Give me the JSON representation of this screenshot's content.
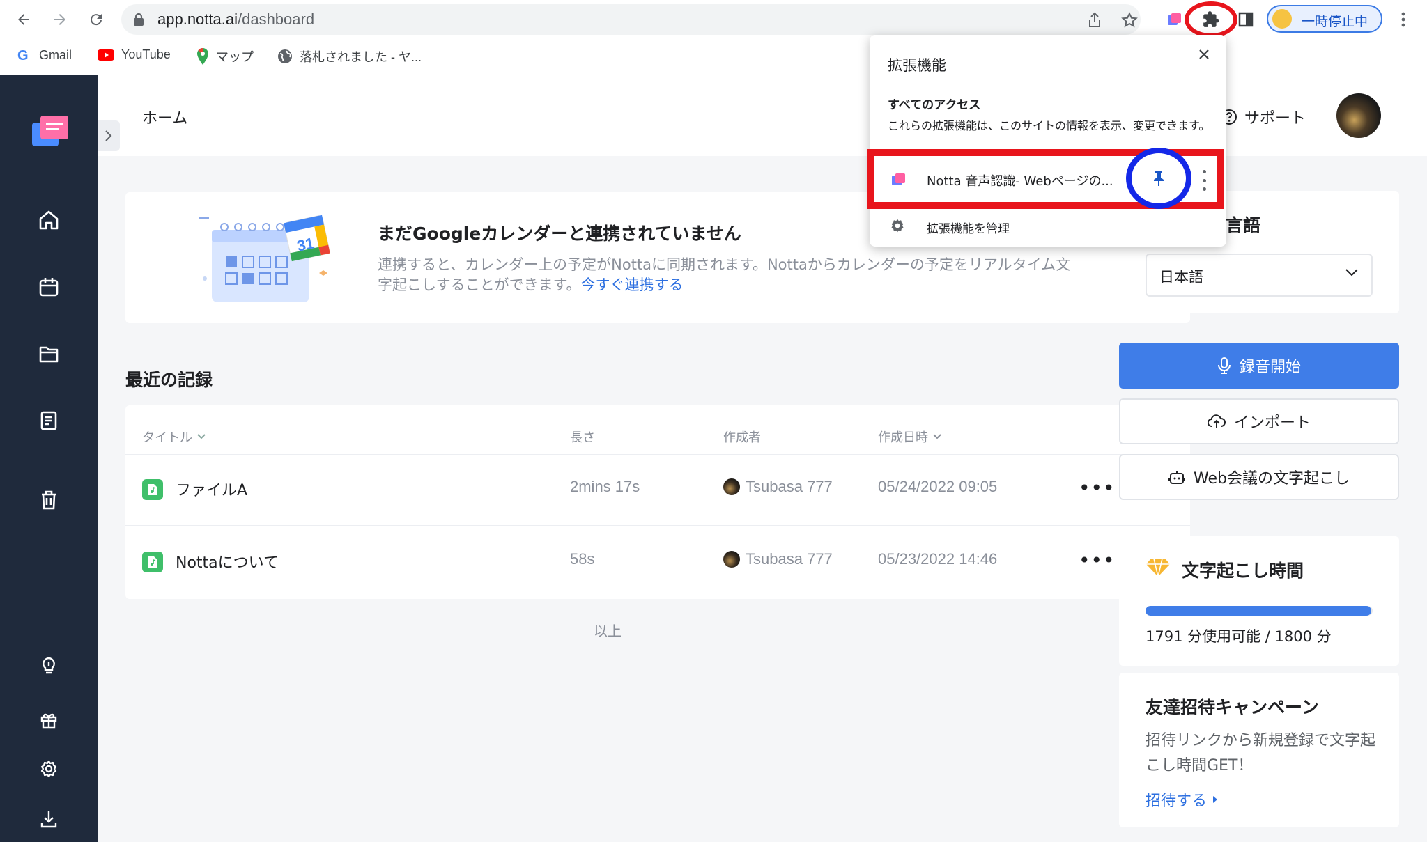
{
  "browser": {
    "url_host": "app.notta.ai",
    "url_path": "/dashboard",
    "profile_status": "一時停止中",
    "bookmarks": [
      {
        "label": "Gmail",
        "icon": "gmail-icon"
      },
      {
        "label": "YouTube",
        "icon": "youtube-icon"
      },
      {
        "label": "マップ",
        "icon": "maps-icon"
      },
      {
        "label": "落札されました - ヤ...",
        "icon": "globe-icon"
      }
    ],
    "colors": {
      "highlight_red": "#e8151c",
      "highlight_blue": "#1428e8"
    }
  },
  "extensions_popup": {
    "title": "拡張機能",
    "section": "すべてのアクセス",
    "note": "これらの拡張機能は、このサイトの情報を表示、変更できます。",
    "extension_name": "Notta 音声認識- Webページの...",
    "manage_label": "拡張機能を管理"
  },
  "header": {
    "title": "ホーム",
    "support": "サポート"
  },
  "gcal_banner": {
    "title": "まだGoogleカレンダーと連携されていません",
    "desc": "連携すると、カレンダー上の予定がNottaに同期されます。Nottaからカレンダーの予定をリアルタイム文字起こしすることができます。",
    "link": "今すぐ連携する",
    "calendar_day": "31"
  },
  "recent": {
    "title": "最近の記録",
    "columns": [
      "タイトル",
      "長さ",
      "作成者",
      "作成日時"
    ],
    "rows": [
      {
        "title": "ファイルA",
        "length": "2mins 17s",
        "author": "Tsubasa 777",
        "date": "05/24/2022 09:05"
      },
      {
        "title": "Nottaについて",
        "length": "58s",
        "author": "Tsubasa 777",
        "date": "05/23/2022 14:46"
      }
    ],
    "more": "•••",
    "end": "以上"
  },
  "right": {
    "lang_label": "し言語",
    "lang_value": "日本語",
    "record_btn": "録音開始",
    "import_btn": "インポート",
    "web_btn": "Web会議の文字起こし",
    "time_title": "文字起こし時間",
    "usage_text": "1791 分使用可能 / 1800 分",
    "usage_fraction": 0.995,
    "invite_title": "友達招待キャンペーン",
    "invite_desc": "招待リンクから新規登録で文字起こし時間GET！",
    "invite_link": "招待する"
  }
}
